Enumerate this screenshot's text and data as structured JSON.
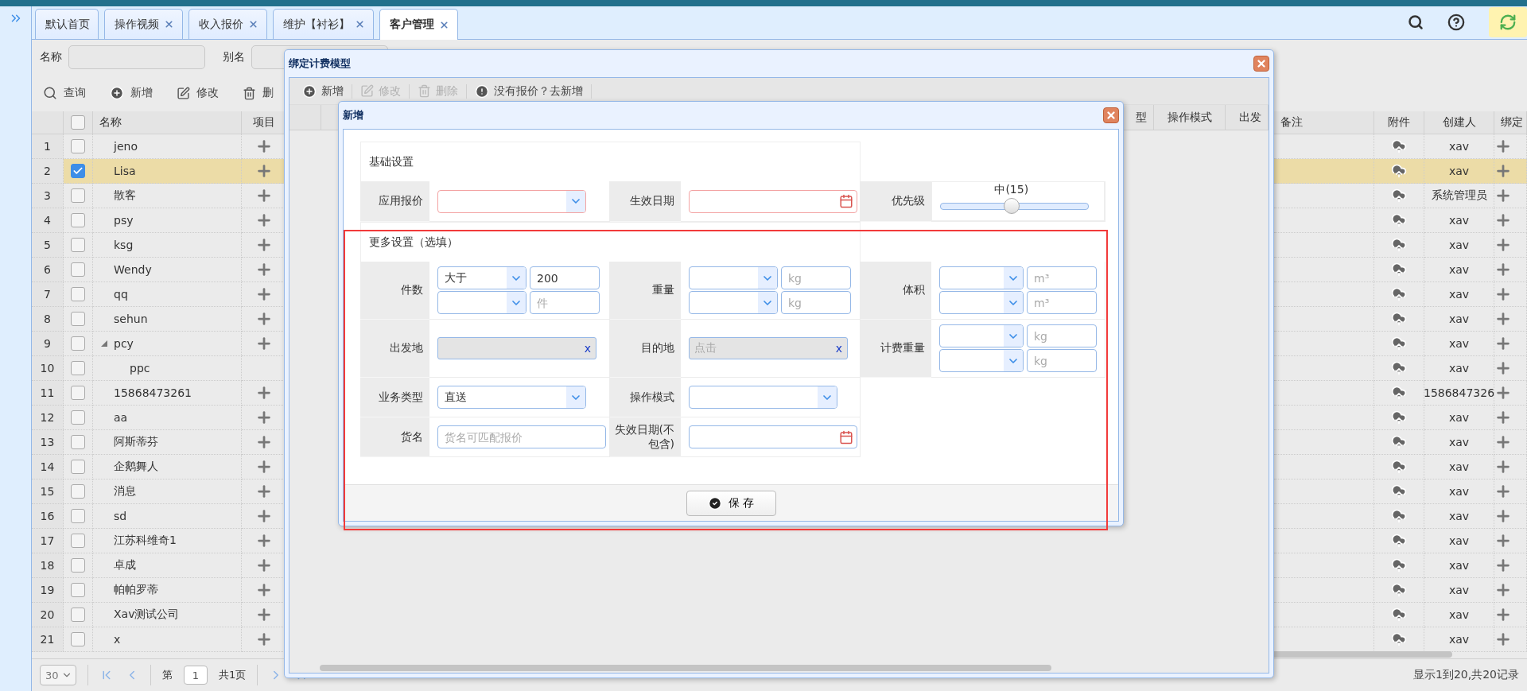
{
  "tabs": [
    {
      "label": "默认首页",
      "selected": false,
      "closable": false
    },
    {
      "label": "操作视频",
      "selected": false,
      "closable": true
    },
    {
      "label": "收入报价",
      "selected": false,
      "closable": true
    },
    {
      "label": "维护【衬衫】",
      "selected": false,
      "closable": true
    },
    {
      "label": "客户管理",
      "selected": true,
      "closable": true
    }
  ],
  "search_form": {
    "fields": [
      {
        "label": "名称"
      },
      {
        "label": "别名"
      }
    ]
  },
  "toolbar": [
    {
      "kind": "search",
      "label": "查询"
    },
    {
      "kind": "add",
      "label": "新增"
    },
    {
      "kind": "edit",
      "label": "修改"
    },
    {
      "kind": "delete",
      "label": "删"
    }
  ],
  "table": {
    "select_all_checked": false,
    "columns": {
      "left": [
        "名称",
        "项目"
      ],
      "right": [
        "备注",
        "附件",
        "创建人",
        "绑定"
      ]
    },
    "rows": [
      {
        "no": "1",
        "name": "jeno",
        "checked": false,
        "creator": "xav"
      },
      {
        "no": "2",
        "name": "Lisa",
        "checked": true,
        "creator": "xav"
      },
      {
        "no": "3",
        "name": "散客",
        "checked": false,
        "creator": "系统管理员"
      },
      {
        "no": "4",
        "name": "psy",
        "checked": false,
        "creator": "xav"
      },
      {
        "no": "5",
        "name": "ksg",
        "checked": false,
        "creator": "xav"
      },
      {
        "no": "6",
        "name": "Wendy",
        "checked": false,
        "creator": "xav"
      },
      {
        "no": "7",
        "name": "qq",
        "checked": false,
        "creator": "xav"
      },
      {
        "no": "8",
        "name": "sehun",
        "checked": false,
        "creator": "xav"
      },
      {
        "no": "9",
        "name": "pcy",
        "checked": false,
        "creator": "xav",
        "expanded": true,
        "children": [
          {
            "no": "10",
            "name": "ppc",
            "checked": false,
            "creator": "xav"
          }
        ]
      },
      {
        "no": "11",
        "name": "15868473261",
        "checked": false,
        "creator": "1586847326"
      },
      {
        "no": "12",
        "name": "aa",
        "checked": false,
        "creator": "xav"
      },
      {
        "no": "13",
        "name": "阿斯蒂芬",
        "checked": false,
        "creator": "xav"
      },
      {
        "no": "14",
        "name": "企鹅舞人",
        "checked": false,
        "creator": "xav"
      },
      {
        "no": "15",
        "name": "消息",
        "checked": false,
        "creator": "xav"
      },
      {
        "no": "16",
        "name": "sd",
        "checked": false,
        "creator": "xav"
      },
      {
        "no": "17",
        "name": "江苏科维奇1",
        "checked": false,
        "creator": "xav"
      },
      {
        "no": "18",
        "name": "卓成",
        "checked": false,
        "creator": "xav"
      },
      {
        "no": "19",
        "name": "帕帕罗蒂",
        "checked": false,
        "creator": "xav"
      },
      {
        "no": "20",
        "name": "Xav测试公司",
        "checked": false,
        "creator": "xav"
      },
      {
        "no": "21",
        "name": "x",
        "checked": false,
        "creator": "xav"
      }
    ]
  },
  "pager": {
    "page_size": "30",
    "page_prefix": "第",
    "page": "1",
    "page_total": "共1页",
    "summary": "显示1到20,共20记录"
  },
  "bind_dialog": {
    "title": "绑定计费模型",
    "toolbar": [
      {
        "kind": "add",
        "label": "新增",
        "disabled": false
      },
      {
        "kind": "edit",
        "label": "修改",
        "disabled": true
      },
      {
        "kind": "delete",
        "label": "删除",
        "disabled": true
      },
      {
        "kind": "notice",
        "label": "没有报价？去新增",
        "disabled": false
      }
    ],
    "columns": [
      "型",
      "操作模式",
      "出发"
    ]
  },
  "add_dialog": {
    "title": "新增",
    "save_label": "保 存",
    "sections": [
      {
        "title": "基础设置",
        "rows": [
          [
            {
              "label": "应用报价",
              "kind": "combo",
              "invalid": true
            },
            {
              "label": "生效日期",
              "kind": "date",
              "invalid": true
            },
            {
              "label": "优先级",
              "kind": "slider",
              "level": 0.48,
              "value_label": "中(15)"
            }
          ]
        ]
      },
      {
        "title": "更多设置（选填）",
        "rows": [
          [
            {
              "label": "件数",
              "kind": "pair",
              "items": [
                {
                  "select": "大于",
                  "value": "200"
                },
                {
                  "placeholder": "件"
                }
              ]
            },
            {
              "label": "重量",
              "kind": "pair",
              "items": [
                {
                  "placeholder": "kg"
                },
                {
                  "placeholder": "kg"
                }
              ]
            },
            {
              "label": "体积",
              "kind": "pair",
              "items": [
                {
                  "placeholder": "m³"
                },
                {
                  "placeholder": "m³"
                }
              ]
            }
          ],
          [
            {
              "label": "出发地",
              "kind": "picker",
              "clear": "x"
            },
            {
              "label": "目的地",
              "kind": "picker",
              "placeholder": "点击",
              "clear": "x"
            },
            {
              "label": "计费重量",
              "kind": "pair",
              "items": [
                {
                  "placeholder": "kg"
                },
                {
                  "placeholder": "kg"
                }
              ]
            }
          ],
          [
            {
              "label": "业务类型",
              "kind": "combo",
              "value": "直送",
              "invalid": false
            },
            {
              "label": "操作模式",
              "kind": "combo",
              "invalid": false
            }
          ],
          [
            {
              "label": "货名",
              "kind": "text",
              "placeholder": "货名可匹配报价",
              "invalid": false
            },
            {
              "label": "失效日期(不包含)",
              "kind": "date",
              "invalid": false
            }
          ]
        ]
      }
    ]
  }
}
